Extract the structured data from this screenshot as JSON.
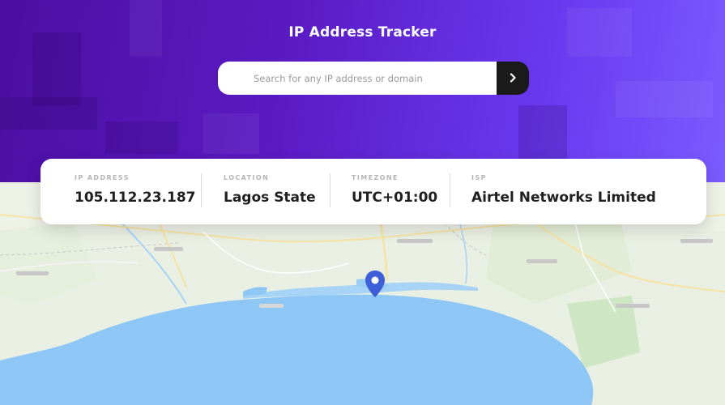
{
  "app": {
    "title": "IP Address Tracker"
  },
  "search": {
    "placeholder": "Search for any IP address or domain",
    "submit_icon": "chevron-right-icon"
  },
  "info": {
    "ip": {
      "label": "IP Address",
      "value": "105.112.23.187"
    },
    "location": {
      "label": "Location",
      "value": "Lagos State"
    },
    "timezone": {
      "label": "Timezone",
      "value": "UTC+01:00"
    },
    "isp": {
      "label": "ISP",
      "value": "Airtel Networks Limited"
    }
  },
  "map": {
    "marker_icon": "location-pin-icon"
  },
  "colors": {
    "header_start": "#4a0fa0",
    "header_end": "#7a5cff",
    "button": "#1a1a1a",
    "water": "#8ec7f5",
    "land": "#e9efe2",
    "marker": "#3f5fd8"
  }
}
